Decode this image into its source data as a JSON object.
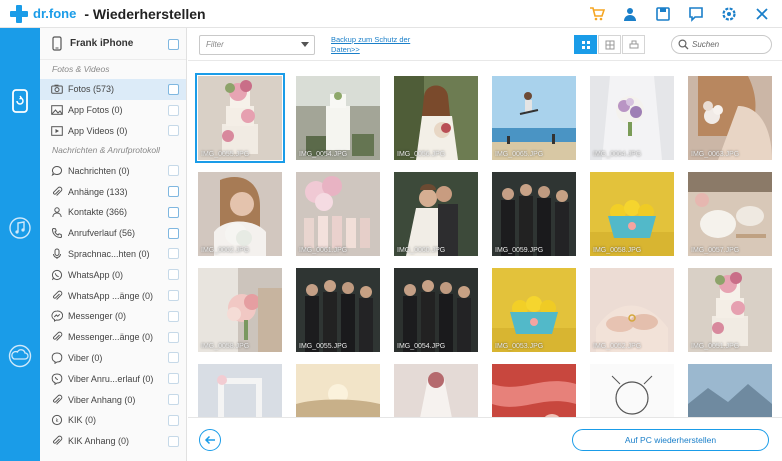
{
  "titlebar": {
    "logo_text": "dr.fone",
    "title": "- Wiederherstellen",
    "icons": [
      "cart-icon",
      "user-icon",
      "save-icon",
      "feedback-icon",
      "settings-icon",
      "close-icon"
    ],
    "accent": "#F5A623"
  },
  "rail": {
    "items": [
      "phone-restore-icon",
      "music-icon",
      "cloud-icon"
    ],
    "color": "#1A9CE8"
  },
  "sidebar": {
    "device_name": "Frank iPhone",
    "section_media": "Fotos & Videos",
    "media_items": [
      {
        "label": "Fotos (573)",
        "icon": "camera-icon"
      },
      {
        "label": "App Fotos (0)",
        "icon": "image-icon"
      },
      {
        "label": "App Videos (0)",
        "icon": "video-icon"
      }
    ],
    "section_messages": "Nachrichten & Anrufprotokoll",
    "message_items": [
      {
        "label": "Nachrichten (0)",
        "icon": "message-icon"
      },
      {
        "label": "Anhänge (133)",
        "icon": "paperclip-icon"
      },
      {
        "label": "Kontakte (366)",
        "icon": "contact-icon"
      },
      {
        "label": "Anrufverlauf (56)",
        "icon": "phone-icon"
      },
      {
        "label": "Sprachnac...hten (0)",
        "icon": "voicemail-icon"
      },
      {
        "label": "WhatsApp (0)",
        "icon": "whatsapp-icon"
      },
      {
        "label": "WhatsApp ...änge (0)",
        "icon": "paperclip-icon"
      },
      {
        "label": "Messenger (0)",
        "icon": "messenger-icon"
      },
      {
        "label": "Messenger...änge (0)",
        "icon": "paperclip-icon"
      },
      {
        "label": "Viber (0)",
        "icon": "viber-icon"
      },
      {
        "label": "Viber Anru...erlauf (0)",
        "icon": "viber-call-icon"
      },
      {
        "label": "Viber Anhang (0)",
        "icon": "paperclip-icon"
      },
      {
        "label": "KIK (0)",
        "icon": "kik-icon"
      },
      {
        "label": "KIK Anhang (0)",
        "icon": "paperclip-icon"
      }
    ]
  },
  "toolbar": {
    "filter_value": "Filter",
    "backup_link": "Backup zum Schutz der Daten>>",
    "search_placeholder": "Suchen"
  },
  "gallery": {
    "rows": [
      [
        "IMG_0055.JPG",
        "IMG_0054.JPG",
        "IMG_0056.JPG",
        "IMG_0065.JPG",
        "IMG_0064.JPG",
        "IMG_0063.JPG"
      ],
      [
        "IMG_0062.JPG",
        "IMG_0061.JPG",
        "IMG_0060.JPG",
        "IMG_0059.JPG",
        "IMG_0058.JPG",
        "IMG_0057.JPG"
      ],
      [
        "IMG_0058.JPG",
        "IMG_0055.JPG",
        "IMG_0054.JPG",
        "IMG_0053.JPG",
        "IMG_0052.JPG",
        "IMG_0051.JPG"
      ],
      [
        "",
        "",
        "",
        "",
        "",
        ""
      ]
    ]
  },
  "bottom": {
    "restore_label": "Auf PC wiederherstellen"
  }
}
